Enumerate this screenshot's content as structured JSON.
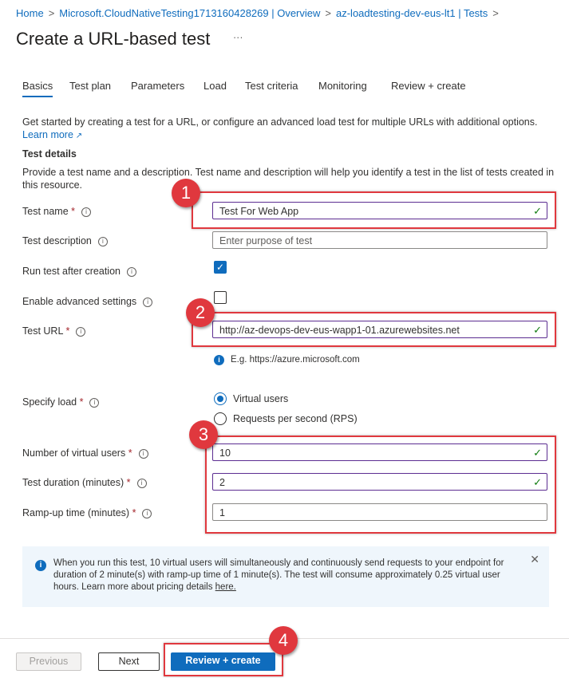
{
  "breadcrumb": [
    "Home",
    "Microsoft.CloudNativeTesting1713160428269 | Overview",
    "az-loadtesting-dev-eus-lt1 | Tests"
  ],
  "title": "Create a URL-based test",
  "more": "···",
  "tabs": [
    "Basics",
    "Test plan",
    "Parameters",
    "Load",
    "Test criteria",
    "Monitoring",
    "Review + create"
  ],
  "intro": "Get started by creating a test for a URL, or configure an advanced load test for multiple URLs with additional options.",
  "learn_more": "Learn more",
  "section_title": "Test details",
  "section_desc": "Provide a test name and a description. Test name and description will help you identify a test in the list of tests created in this resource.",
  "fields": {
    "test_name": {
      "label": "Test name",
      "value": "Test For Web App"
    },
    "test_description": {
      "label": "Test description",
      "placeholder": "Enter purpose of test"
    },
    "run_after": {
      "label": "Run test after creation",
      "checked": true
    },
    "advanced": {
      "label": "Enable advanced settings",
      "checked": false
    },
    "test_url": {
      "label": "Test URL",
      "value": "http://az-devops-dev-eus-wapp1-01.azurewebsites.net",
      "hint": "E.g. https://azure.microsoft.com"
    },
    "specify_load": {
      "label": "Specify load",
      "options": [
        "Virtual users",
        "Requests per second (RPS)"
      ],
      "selected": "Virtual users"
    },
    "virtual_users": {
      "label": "Number of virtual users",
      "value": "10"
    },
    "duration": {
      "label": "Test duration (minutes)",
      "value": "2"
    },
    "rampup": {
      "label": "Ramp-up time (minutes)",
      "value": "1"
    }
  },
  "info": {
    "text": "When you run this test, 10 virtual users will simultaneously and continuously send requests to your endpoint for duration of 2 minute(s) with ramp-up time of 1 minute(s). The test will consume approximately 0.25 virtual user hours. Learn more about pricing details ",
    "link": "here."
  },
  "buttons": {
    "previous": "Previous",
    "next": "Next",
    "review": "Review + create"
  },
  "annotations": [
    "1",
    "2",
    "3",
    "4"
  ],
  "colors": {
    "accent": "#0f6cbd",
    "annotation": "#e0383e"
  }
}
